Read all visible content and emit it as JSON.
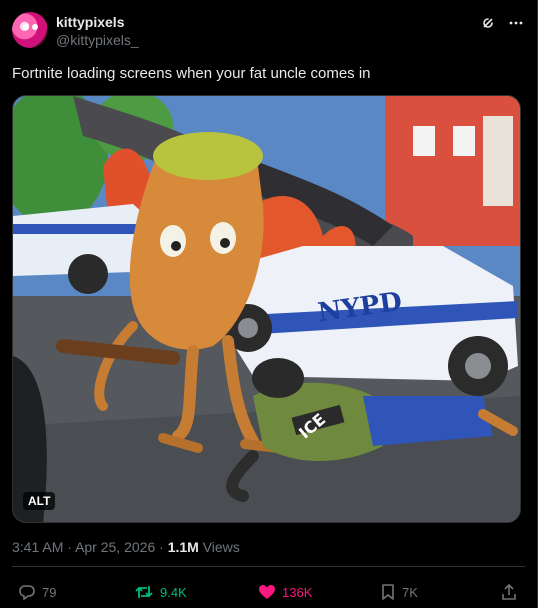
{
  "author": {
    "display_name": "kittypixels",
    "handle": "@kittypixels_"
  },
  "post": {
    "text": "Fortnite loading screens when your fat uncle comes in",
    "media_alt_badge": "ALT"
  },
  "meta": {
    "time": "3:41 AM",
    "date": "Apr 25, 2026",
    "views_count": "1.1M",
    "views_label": "Views",
    "separator": "·"
  },
  "actions": {
    "replies": "79",
    "reposts": "9.4K",
    "likes": "136K",
    "bookmarks": "7K"
  },
  "colors": {
    "background": "#000000",
    "text": "#e7e9ea",
    "muted": "#71767b",
    "repost_active": "#00ba7c",
    "like_active": "#f91880",
    "divider": "#2f3336"
  },
  "icons": {
    "header": [
      "grok-icon",
      "more-icon"
    ],
    "actions": [
      "reply-icon",
      "repost-icon",
      "like-icon",
      "bookmark-icon",
      "share-icon"
    ]
  }
}
